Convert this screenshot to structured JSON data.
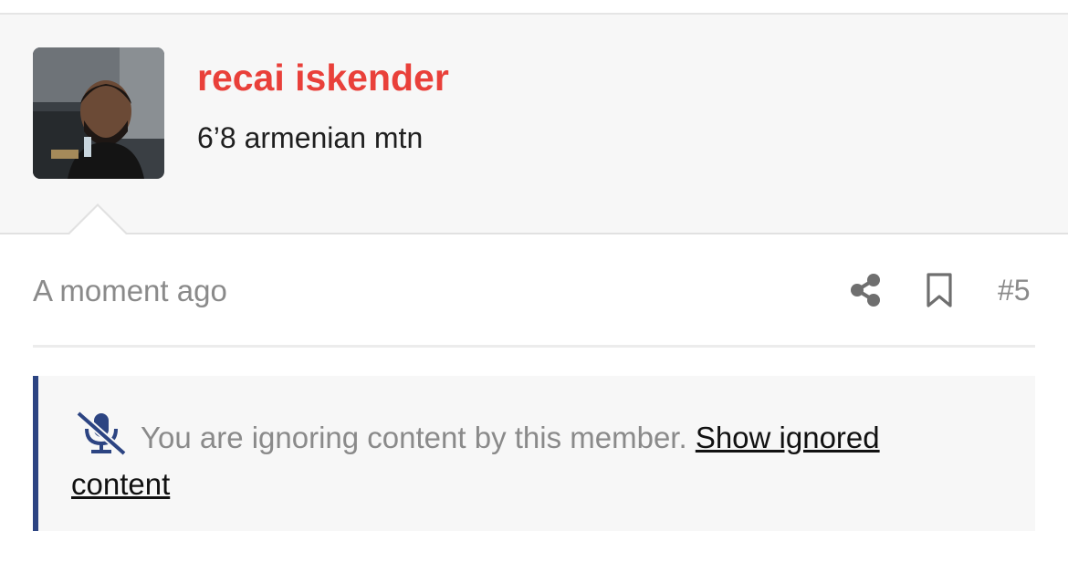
{
  "user": {
    "name": "recai iskender",
    "title": "6’8 armenian mtn"
  },
  "post": {
    "timestamp": "A moment ago",
    "number": "#5",
    "share_icon": "share-icon",
    "bookmark_icon": "bookmark-icon"
  },
  "ignored": {
    "icon": "mute-microphone-icon",
    "message": "You are ignoring content by this member.",
    "link_label": "Show ignored content",
    "accent_color": "#2c4482"
  },
  "colors": {
    "username": "#e9403a",
    "muted_text": "#8a8a8a"
  }
}
